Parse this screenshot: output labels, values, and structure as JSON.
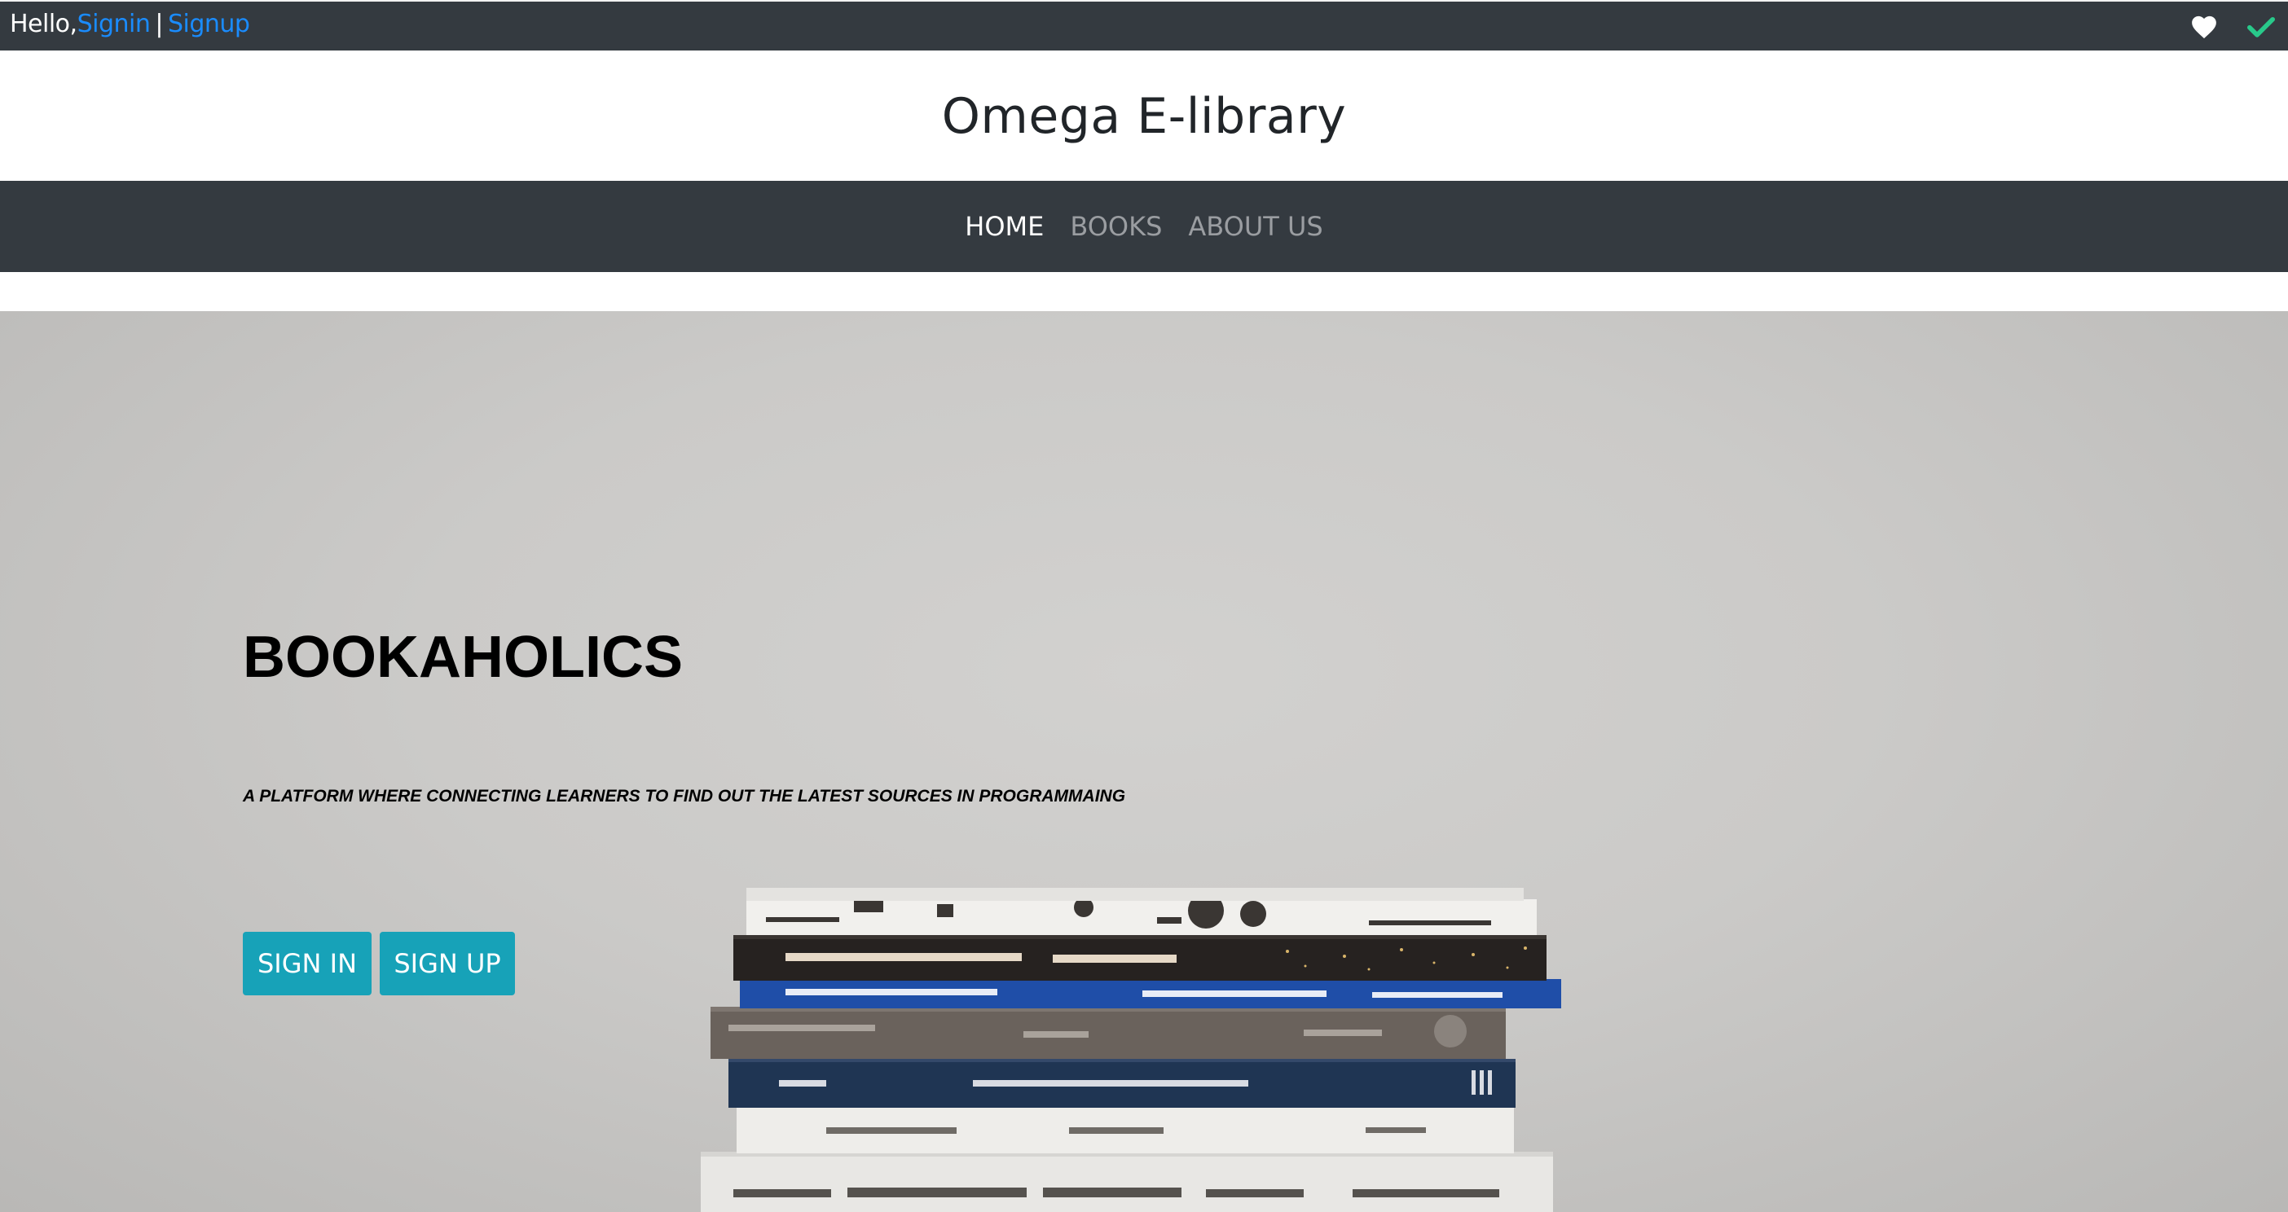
{
  "topbar": {
    "greeting": "Hello,",
    "signin_link": "Signin",
    "separator": "|",
    "signup_link": "Signup",
    "icons": [
      "heart-icon",
      "check-icon"
    ]
  },
  "brand": {
    "title": "Omega E-library"
  },
  "nav": {
    "items": [
      {
        "label": "HOME",
        "active": true
      },
      {
        "label": "BOOKS",
        "active": false
      },
      {
        "label": "ABOUT US",
        "active": false
      }
    ]
  },
  "hero": {
    "title": "BOOKAHOLICS",
    "subtitle": "A PLATFORM WHERE CONNECTING LEARNERS TO FIND OUT THE LATEST SOURCES IN PROGRAMMAING",
    "signin_button": "SIGN IN",
    "signup_button": "SIGN UP"
  },
  "colors": {
    "dark_bar": "#343a40",
    "link": "#1a8cff",
    "button": "#17a2b8",
    "check": "#28c98a"
  }
}
